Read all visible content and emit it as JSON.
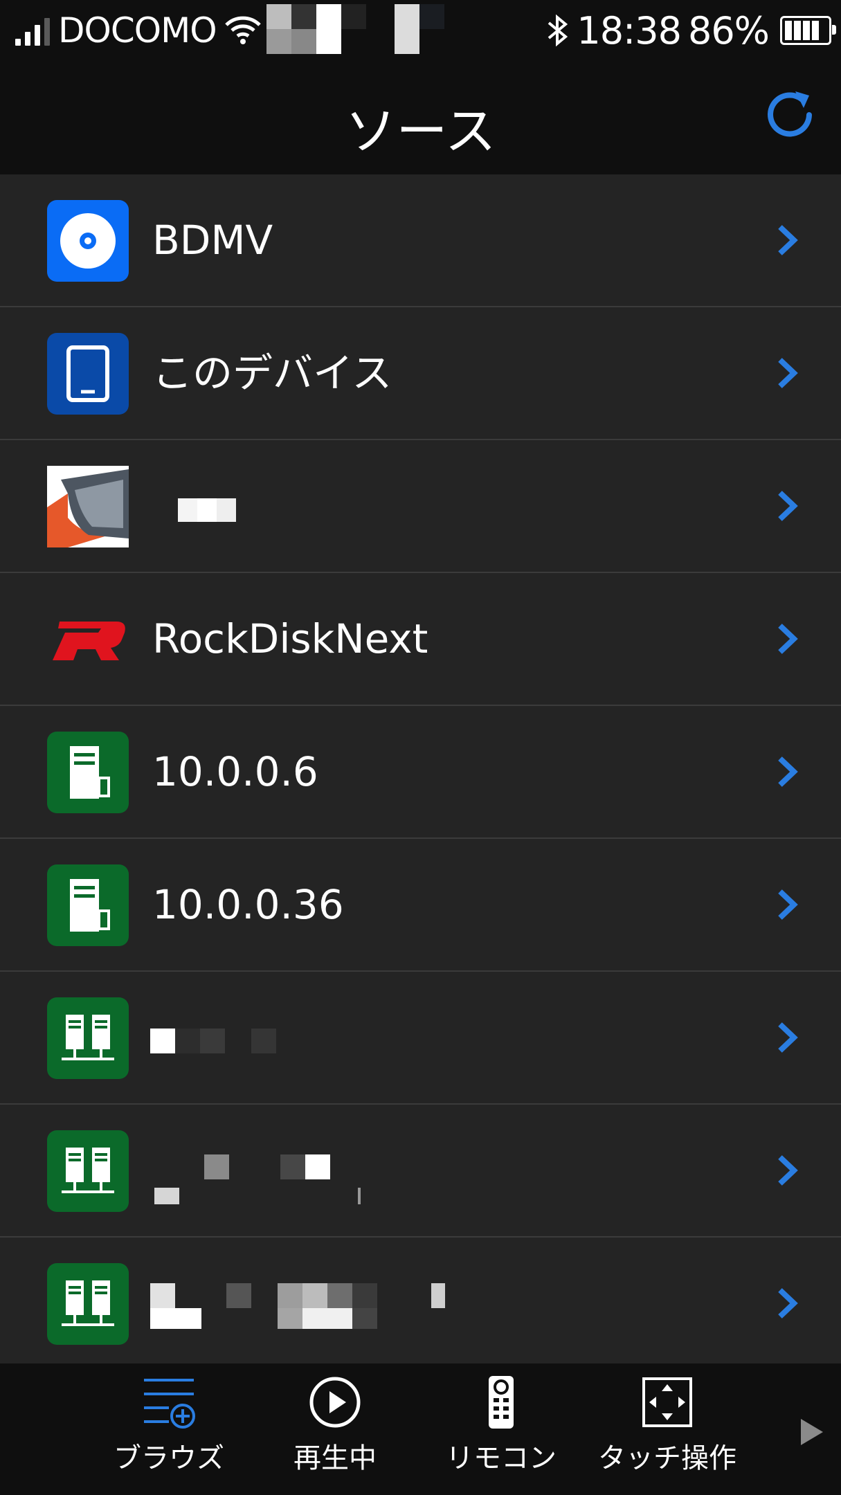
{
  "status": {
    "carrier": "DOCOMO",
    "time": "18:38",
    "battery_pct": "86%"
  },
  "nav": {
    "title": "ソース",
    "refresh_icon": "refresh-icon"
  },
  "sources": [
    {
      "label": "BDMV",
      "icon": "disc-icon",
      "icon_bg": "#0a6cf5"
    },
    {
      "label": "このデバイス",
      "icon": "tablet-icon",
      "icon_bg": "#0a4aa8"
    },
    {
      "label": "",
      "icon": "app-logo-icon",
      "icon_bg": "#ffffff"
    },
    {
      "label": "RockDiskNext",
      "icon": "rockdisk-logo-icon",
      "icon_bg": "transparent"
    },
    {
      "label": "10.0.0.6",
      "icon": "server-icon",
      "icon_bg": "#0b6a2a"
    },
    {
      "label": "10.0.0.36",
      "icon": "server-icon",
      "icon_bg": "#0b6a2a"
    },
    {
      "label": "",
      "icon": "network-servers-icon",
      "icon_bg": "#0b6a2a"
    },
    {
      "label": "",
      "icon": "network-servers-icon",
      "icon_bg": "#0b6a2a"
    },
    {
      "label": "",
      "icon": "network-servers-icon",
      "icon_bg": "#0b6a2a"
    }
  ],
  "tabs": [
    {
      "label": "ブラウズ",
      "icon": "browse-icon",
      "active": true
    },
    {
      "label": "再生中",
      "icon": "play-icon",
      "active": false
    },
    {
      "label": "リモコン",
      "icon": "remote-icon",
      "active": false
    },
    {
      "label": "タッチ操作",
      "icon": "touch-icon",
      "active": false
    }
  ],
  "colors": {
    "accent": "#2a7de1",
    "background": "#242424",
    "bar": "#0f0f0f"
  }
}
